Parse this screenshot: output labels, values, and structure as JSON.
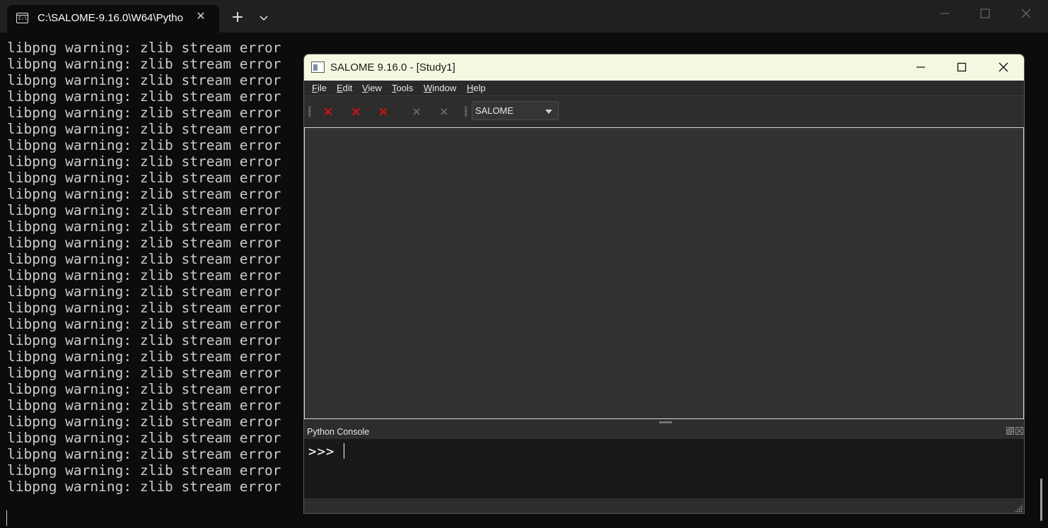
{
  "terminal": {
    "tab_title": "C:\\SALOME-9.16.0\\W64\\Pytho",
    "tab_icon_text": "C:\\",
    "lines": [
      "libpng warning: zlib stream error",
      "libpng warning: zlib stream error",
      "libpng warning: zlib stream error",
      "libpng warning: zlib stream error",
      "libpng warning: zlib stream error",
      "libpng warning: zlib stream error",
      "libpng warning: zlib stream error",
      "libpng warning: zlib stream error",
      "libpng warning: zlib stream error",
      "libpng warning: zlib stream error",
      "libpng warning: zlib stream error",
      "libpng warning: zlib stream error",
      "libpng warning: zlib stream error",
      "libpng warning: zlib stream error",
      "libpng warning: zlib stream error",
      "libpng warning: zlib stream error",
      "libpng warning: zlib stream error",
      "libpng warning: zlib stream error",
      "libpng warning: zlib stream error",
      "libpng warning: zlib stream error",
      "libpng warning: zlib stream error",
      "libpng warning: zlib stream error",
      "libpng warning: zlib stream error",
      "libpng warning: zlib stream error",
      "libpng warning: zlib stream error",
      "libpng warning: zlib stream error",
      "libpng warning: zlib stream error",
      "libpng warning: zlib stream error"
    ]
  },
  "salome": {
    "title": "SALOME 9.16.0 - [Study1]",
    "menu": [
      {
        "ul": "F",
        "rest": "ile"
      },
      {
        "ul": "E",
        "rest": "dit"
      },
      {
        "ul": "V",
        "rest": "iew"
      },
      {
        "ul": "T",
        "rest": "ools"
      },
      {
        "ul": "W",
        "rest": "indow"
      },
      {
        "ul": "H",
        "rest": "elp"
      }
    ],
    "module_selector": "SALOME",
    "dock_title": "Python Console",
    "prompt": ">>>"
  },
  "colors": {
    "terminal_bg": "#0c0c0c",
    "terminal_text": "#cccccc",
    "salome_titlebar": "#f4f8e0",
    "toolbar_icon_active": "#d01010",
    "toolbar_icon_disabled": "#6e6e6e"
  }
}
